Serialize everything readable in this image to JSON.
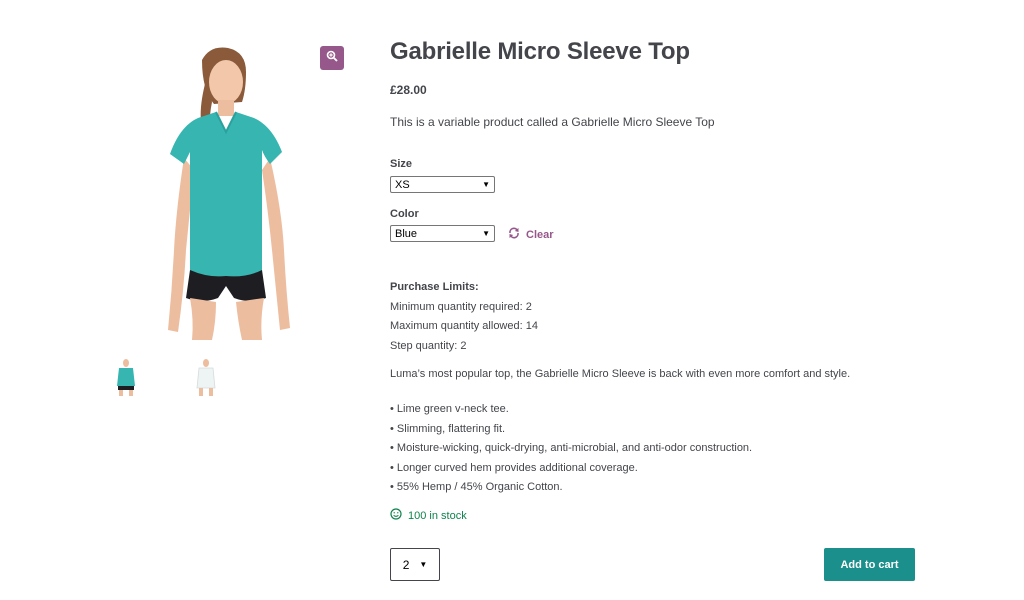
{
  "product": {
    "title": "Gabrielle Micro Sleeve Top",
    "price": "£28.00",
    "short_description": "This is a variable product called a Gabrielle Micro Sleeve Top",
    "long_description": "Luma’s most popular top, the Gabrielle Micro Sleeve is back with even more comfort and style.",
    "bullets": [
      "• Lime green v-neck tee.",
      "• Slimming, flattering fit.",
      "• Moisture-wicking, quick-drying, anti-microbial, and anti-odor construction.",
      "• Longer curved hem provides additional coverage.",
      "• 55% Hemp / 45% Organic Cotton."
    ],
    "stock": "100 in stock"
  },
  "gallery": {
    "zoom_icon": "magnifier-icon",
    "thumbnails": [
      "thumbnail-teal-top",
      "thumbnail-white-top"
    ]
  },
  "variations": {
    "size_label": "Size",
    "size_value": "XS",
    "color_label": "Color",
    "color_value": "Blue",
    "clear_label": "Clear"
  },
  "limits": {
    "heading": "Purchase Limits:",
    "min": "Minimum quantity required: 2",
    "max": "Maximum quantity allowed: 14",
    "step": "Step quantity: 2"
  },
  "cart": {
    "quantity": "2",
    "add_to_cart_label": "Add to cart"
  },
  "colors": {
    "accent": "#96588a",
    "button": "#1a8f8b",
    "stock": "#0f834d",
    "shirt": "#36b5b1"
  }
}
